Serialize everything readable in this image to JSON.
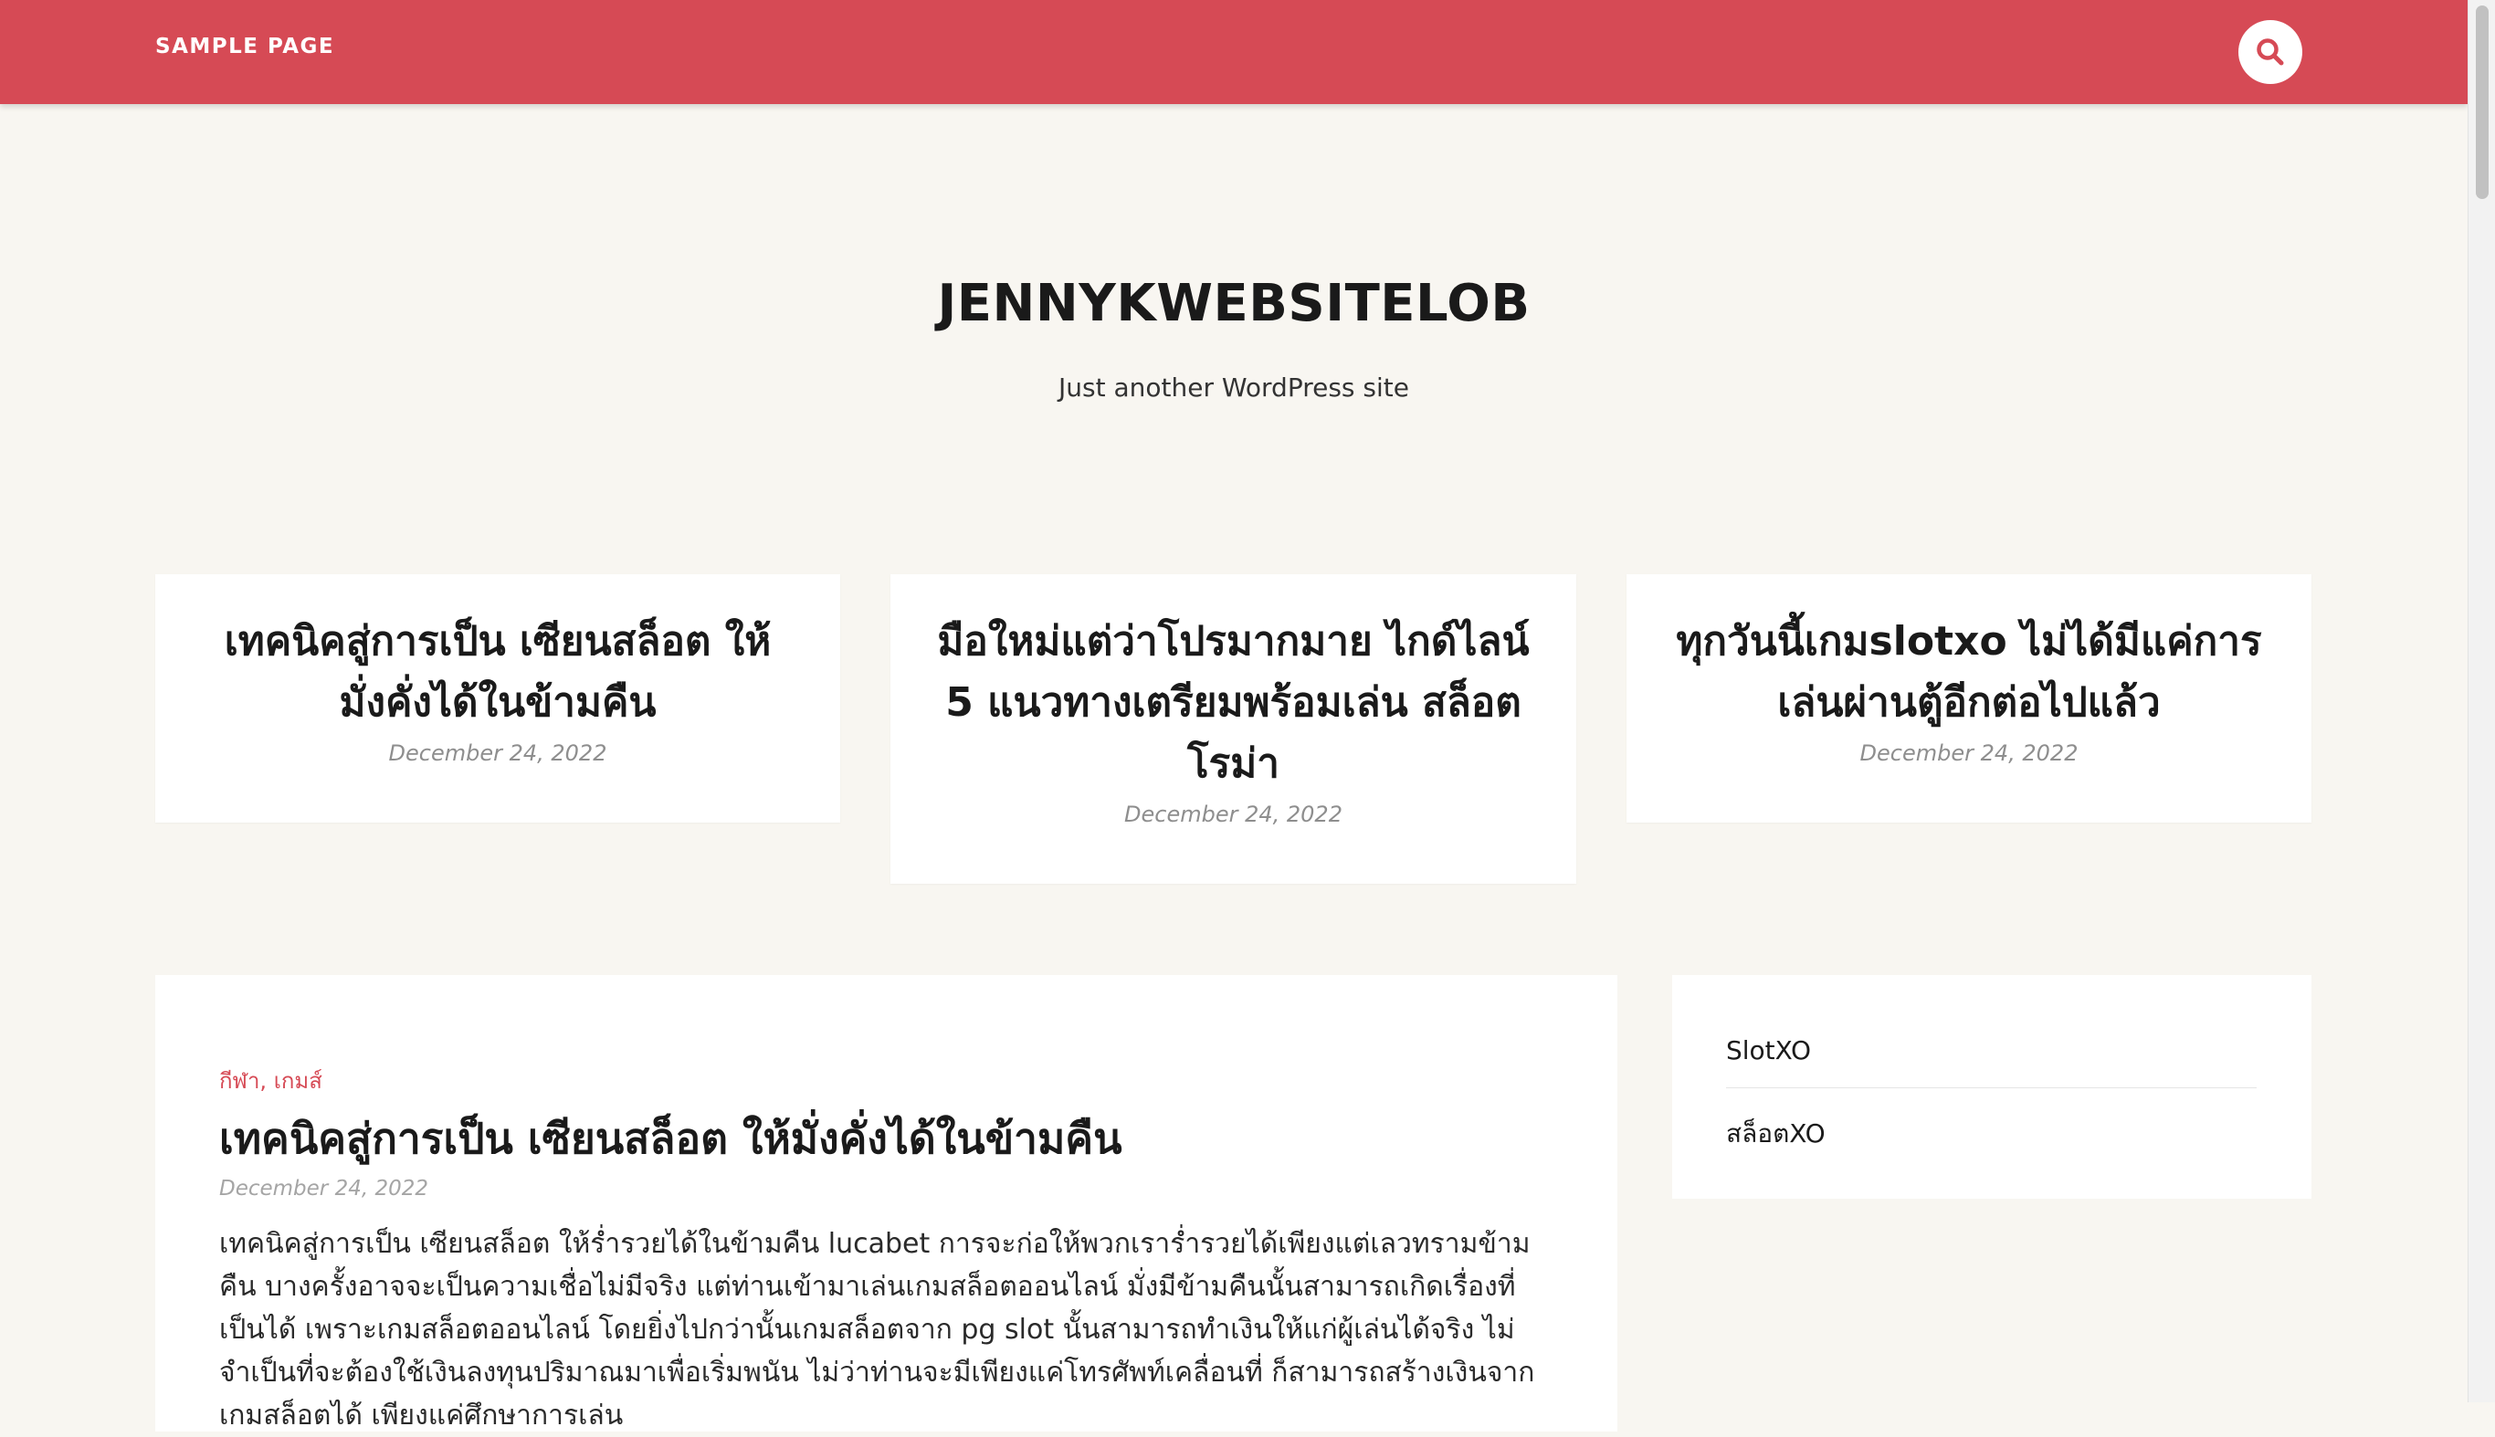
{
  "nav": {
    "menu_label": "SAMPLE PAGE",
    "search_icon": "search-icon",
    "accent_color": "#d64a55"
  },
  "site": {
    "title": "JENNYKWEBSITELOB",
    "description": "Just another WordPress site"
  },
  "featured": [
    {
      "title": "เทคนิคสู่การเป็น เซียนสล็อต ให้มั่งคั่งได้ในข้ามคืน",
      "date": "December 24, 2022"
    },
    {
      "title": "มือใหม่แต่ว่าโปรมากมาย ไกด์ไลน์ 5 แนวทางเตรียมพร้อมเล่น สล็อตโรม่า",
      "date": "December 24, 2022"
    },
    {
      "title": "ทุกวันนี้เกมslotxo ไม่ได้มีแค่การเล่นผ่านตู้อีกต่อไปแล้ว",
      "date": "December 24, 2022"
    }
  ],
  "post": {
    "category_1": "กีฬา",
    "category_sep": ", ",
    "category_2": "เกมส์",
    "title": "เทคนิคสู่การเป็น เซียนสล็อต ให้มั่งคั่งได้ในข้ามคืน",
    "date": "December 24, 2022",
    "excerpt": "เทคนิคสู่การเป็น เซียนสล็อต ให้ร่ำรวยได้ในข้ามคืน lucabet การจะก่อให้พวกเราร่ำรวยได้เพียงแต่เลวทรามข้ามคืน บางครั้งอาจจะเป็นความเชื่อไม่มีจริง แต่ท่านเข้ามาเล่นเกมสล็อตออนไลน์ มั่งมีข้ามคืนนั้นสามารถเกิดเรื่องที่เป็นได้ เพราะเกมสล็อตออนไลน์ โดยยิ่งไปกว่านั้นเกมสล็อตจาก pg slot นั้นสามารถทำเงินให้แก่ผู้เล่นได้จริง ไม่จำเป็นที่จะต้องใช้เงินลงทุนปริมาณมาเพื่อเริ่มพนัน ไม่ว่าท่านจะมีเพียงแค่โทรศัพท์เคลื่อนที่ ก็สามารถสร้างเงินจากเกมสล็อตได้ เพียงแค่ศึกษาการเล่น"
  },
  "sidebar": {
    "items": [
      {
        "label": "SlotXO"
      },
      {
        "label": "สล็อตXO"
      }
    ]
  }
}
